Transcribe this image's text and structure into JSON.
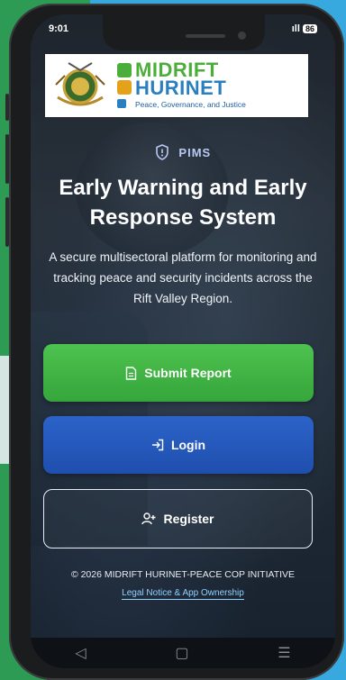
{
  "status_bar": {
    "time": "9:01",
    "signal": "ıll",
    "battery": "86"
  },
  "logo": {
    "line1": "MIDRIFT",
    "line2": "HURINET",
    "tagline": "Peace, Governance, and Justice"
  },
  "badge": {
    "label": "PIMS"
  },
  "hero": {
    "title": "Early Warning and Early Response System",
    "description": "A secure multisectoral platform for monitoring and tracking peace and security incidents across the Rift Valley Region."
  },
  "actions": {
    "submit_label": "Submit Report",
    "login_label": "Login",
    "register_label": "Register"
  },
  "footer": {
    "copyright": "© 2026 MIDRIFT HURINET-PEACE COP INITIATIVE",
    "legal_link": "Legal Notice & App Ownership"
  },
  "nav": {
    "back": "◁",
    "home": "▢",
    "recents": "☰"
  },
  "colors": {
    "submit": "#3fb444",
    "login": "#2657bd",
    "accent_link": "#8fd0ff",
    "brand_green": "#4cae3a",
    "brand_blue": "#2a7fc0"
  },
  "icons": [
    "shield-alert-icon",
    "document-icon",
    "login-arrow-icon",
    "user-add-icon"
  ]
}
